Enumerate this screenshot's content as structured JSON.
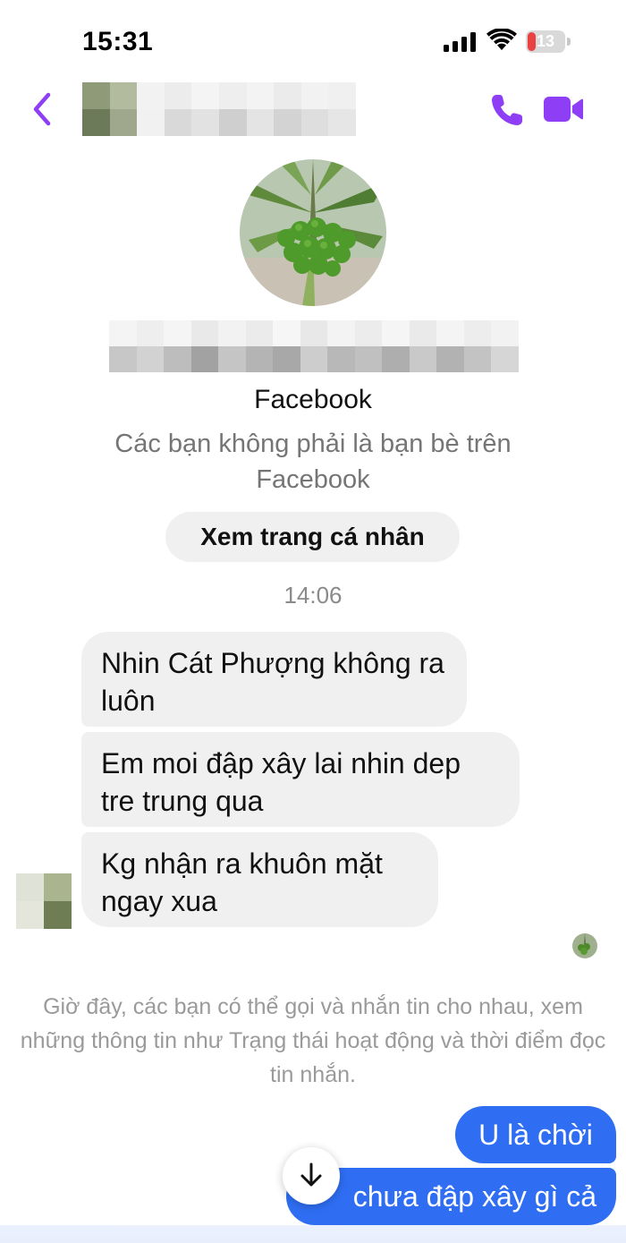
{
  "status_bar": {
    "time": "15:31",
    "battery_level": "13"
  },
  "header": {
    "back_icon": "chevron-left-icon",
    "call_icon": "phone-icon",
    "video_icon": "video-camera-icon",
    "accent_color": "#8e3ff5"
  },
  "profile": {
    "avatar_description": "coconut-palm-photo",
    "network": "Facebook",
    "relationship_note": "Các bạn không phải là bạn bè trên Facebook",
    "view_profile_label": "Xem trang cá nhân"
  },
  "conversation": {
    "timestamp": "14:06",
    "incoming": [
      {
        "text": "Nhin Cát Phượng không ra luôn"
      },
      {
        "text": "Em moi đập xây lai nhin dep tre trung qua"
      },
      {
        "text": "Kg nhận ra khuôn mặt ngay xua"
      }
    ],
    "system_note": "Giờ đây, các bạn có thể gọi và nhắn tin cho nhau, xem những thông tin như Trạng thái hoạt động và thời điểm đọc tin nhắn.",
    "outgoing": [
      {
        "text": "U là chời"
      },
      {
        "text": "chưa đập xây gì cả"
      }
    ],
    "outgoing_color": "#2f6ef3",
    "scroll_down_icon": "arrow-down-icon"
  }
}
